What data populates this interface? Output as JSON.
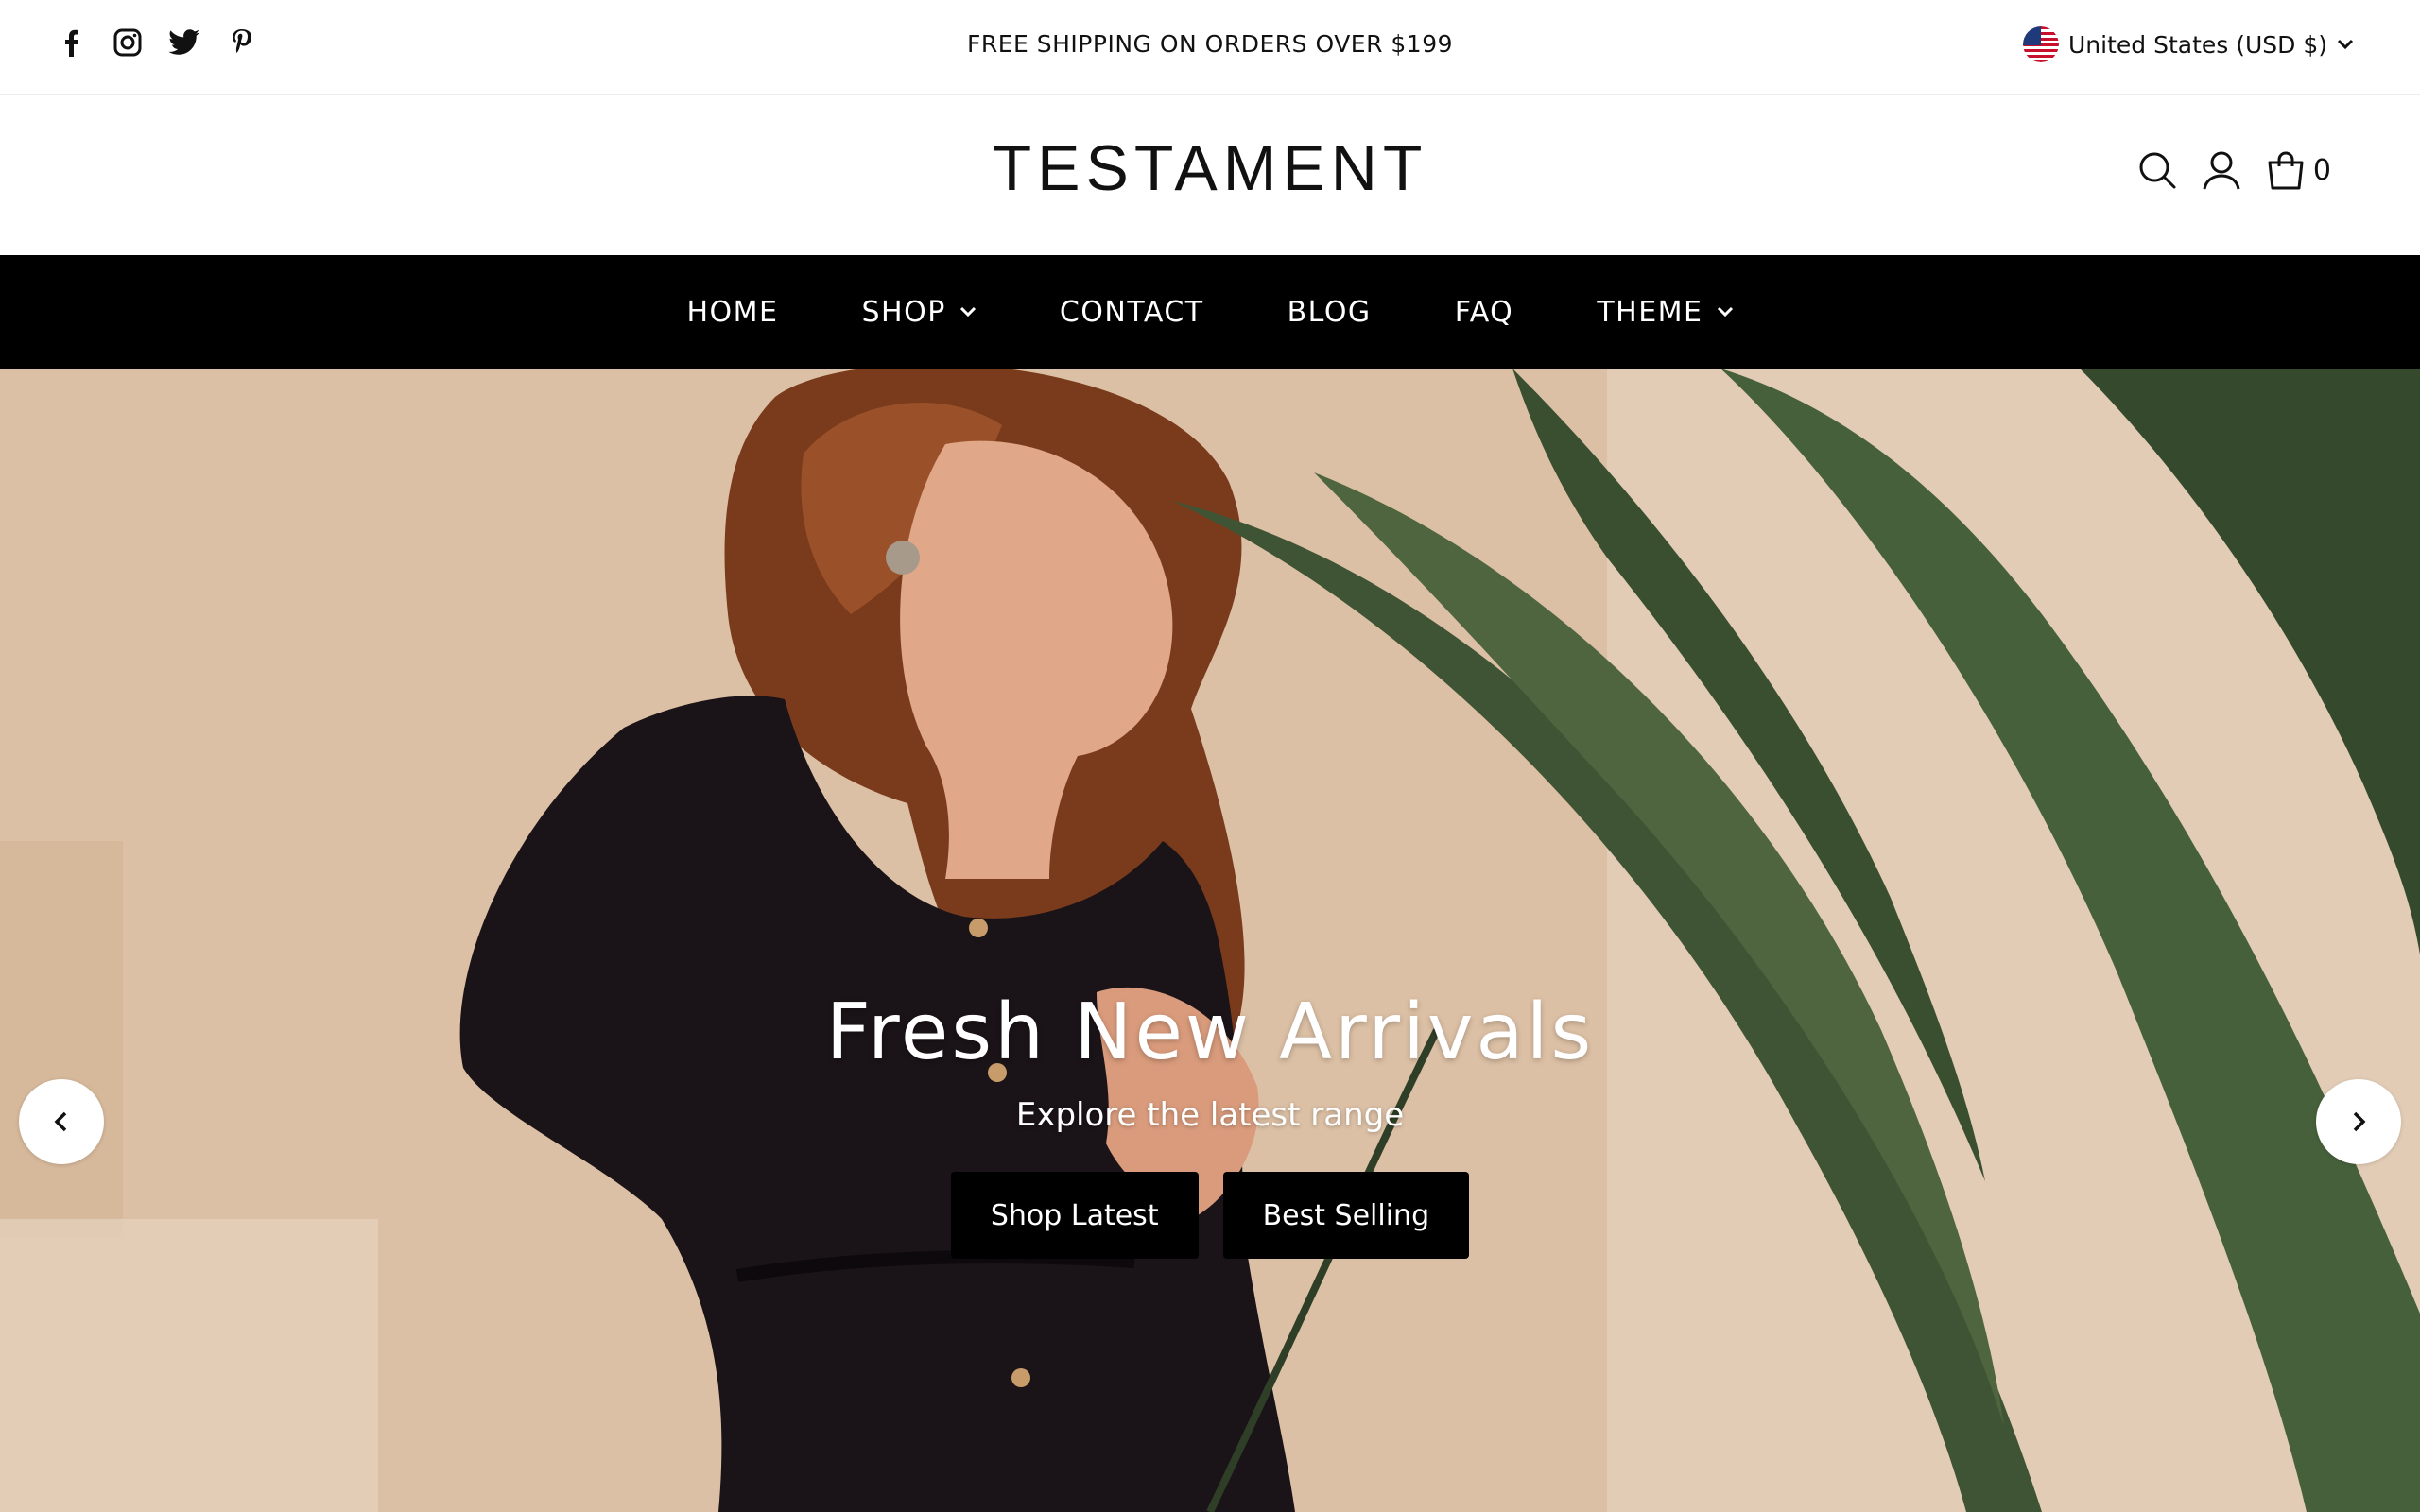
{
  "announcement": {
    "social": [
      "facebook-icon",
      "instagram-icon",
      "twitter-icon",
      "pinterest-icon"
    ],
    "text": "FREE SHIPPING ON ORDERS OVER $199",
    "currency": "United States (USD $)"
  },
  "header": {
    "logo": "TESTAMENT",
    "icons": [
      "search-icon",
      "account-icon",
      "cart-icon"
    ],
    "cart_count": "0"
  },
  "nav": {
    "items": [
      {
        "label": "HOME",
        "dropdown": false
      },
      {
        "label": "SHOP",
        "dropdown": true
      },
      {
        "label": "CONTACT",
        "dropdown": false
      },
      {
        "label": "BLOG",
        "dropdown": false
      },
      {
        "label": "FAQ",
        "dropdown": false
      },
      {
        "label": "THEME",
        "dropdown": true
      }
    ]
  },
  "hero": {
    "title": "Fresh New Arrivals",
    "subtitle": "Explore the latest range",
    "buttons": [
      "Shop Latest",
      "Best Selling"
    ],
    "prev_icon": "chevron-left-icon",
    "next_icon": "chevron-right-icon"
  },
  "colors": {
    "nav_bg": "#000000",
    "button_bg": "#000000",
    "text": "#111111"
  }
}
